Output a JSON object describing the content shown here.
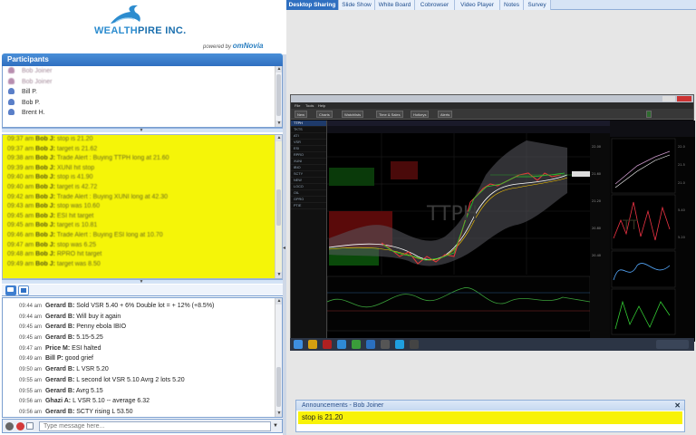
{
  "brand": {
    "name_1": "WEALTH",
    "name_2": "PIRE INC.",
    "powered_label": "powered by",
    "powered_brand": "omNovia"
  },
  "participants": {
    "title": "Participants",
    "items": [
      {
        "name": "Bob Joiner",
        "faded": true
      },
      {
        "name": "Bob Joiner",
        "faded": true
      },
      {
        "name": "Bill P.",
        "faded": false
      },
      {
        "name": "Bob P.",
        "faded": false
      },
      {
        "name": "Brent H.",
        "faded": false
      }
    ]
  },
  "alert_chat": [
    {
      "ts": "09:37 am",
      "who": "Bob J:",
      "text": "stop is 21.20"
    },
    {
      "ts": "09:37 am",
      "who": "Bob J:",
      "text": "target is 21.62"
    },
    {
      "ts": "09:38 am",
      "who": "Bob J:",
      "text": "Trade Alert : Buying TTPH long at 21.60"
    },
    {
      "ts": "09:39 am",
      "who": "Bob J:",
      "text": "XUNI hit stop"
    },
    {
      "ts": "09:40 am",
      "who": "Bob J:",
      "text": "stop is 41.90"
    },
    {
      "ts": "09:40 am",
      "who": "Bob J:",
      "text": "target is 42.72"
    },
    {
      "ts": "09:42 am",
      "who": "Bob J:",
      "text": "Trade Alert : Buying XUNI long at 42.30"
    },
    {
      "ts": "09:43 am",
      "who": "Bob J:",
      "text": "stop was 10.60"
    },
    {
      "ts": "09:45 am",
      "who": "Bob J:",
      "text": "ESI hit target"
    },
    {
      "ts": "09:45 am",
      "who": "Bob J:",
      "text": "target is 10.81"
    },
    {
      "ts": "09:46 am",
      "who": "Bob J:",
      "text": "Trade Alert : Buying ESI long at 10.70"
    },
    {
      "ts": "09:47 am",
      "who": "Bob J:",
      "text": "stop was 6.25"
    },
    {
      "ts": "09:48 am",
      "who": "Bob J:",
      "text": "RPRO hit target"
    },
    {
      "ts": "09:49 am",
      "who": "Bob J:",
      "text": "target was 8.50"
    }
  ],
  "chat": [
    {
      "ts": "09:44 am",
      "who": "Gerard B:",
      "text": "Sold VSR 5.40  + 6% Double lot = + 12% (+8.5%)"
    },
    {
      "ts": "09:44 am",
      "who": "Gerard B:",
      "text": "Will buy it again"
    },
    {
      "ts": "09:45 am",
      "who": "Gerard B:",
      "text": "Penny ebola IBIO"
    },
    {
      "ts": "09:45 am",
      "who": "Gerard B:",
      "text": "5.15-5.25"
    },
    {
      "ts": "09:47 am",
      "who": "Price M:",
      "text": "ESI halted"
    },
    {
      "ts": "09:49 am",
      "who": "Bill P:",
      "text": "good grief"
    },
    {
      "ts": "09:50 am",
      "who": "Gerard B:",
      "text": "L VSR 5.20"
    },
    {
      "ts": "09:55 am",
      "who": "Gerard B:",
      "text": "L second lot VSR 5.10 Avrg 2 lots 5.20"
    },
    {
      "ts": "09:55 am",
      "who": "Gerard B:",
      "text": "Avrg 5.15"
    },
    {
      "ts": "09:56 am",
      "who": "Ghazi A:",
      "text": "L VSR 5.10 -- average 6.32"
    },
    {
      "ts": "09:56 am",
      "who": "Gerard B:",
      "text": "SCTY rising L 53.50"
    }
  ],
  "input": {
    "placeholder": "Type message here..."
  },
  "tabs": [
    {
      "label": "Desktop Sharing",
      "active": true
    },
    {
      "label": "Slide Show",
      "active": false
    },
    {
      "label": "White Board",
      "active": false
    },
    {
      "label": "Cobrowser",
      "active": false
    },
    {
      "label": "Video Player",
      "active": false
    },
    {
      "label": "Notes",
      "active": false
    },
    {
      "label": "Survey",
      "active": false
    }
  ],
  "shared": {
    "watermark": "TTPH",
    "menu": [
      "File",
      "Tools",
      "Help"
    ],
    "toolbar": [
      "New",
      "Charts",
      "Watchlists",
      "Time & Sales",
      "Hotkeys",
      "Alerts"
    ],
    "watchlist": [
      "TTPH",
      "TKTS",
      "ATI",
      "VSR",
      "ESI",
      "RPRO",
      "XUNI",
      "IBIO",
      "SCTY",
      "NEW",
      "LOCO",
      "OIL",
      "GPRO",
      "PTIE"
    ]
  },
  "announcement": {
    "title": "Announcements - Bob Joiner",
    "text": "stop is 21.20"
  }
}
